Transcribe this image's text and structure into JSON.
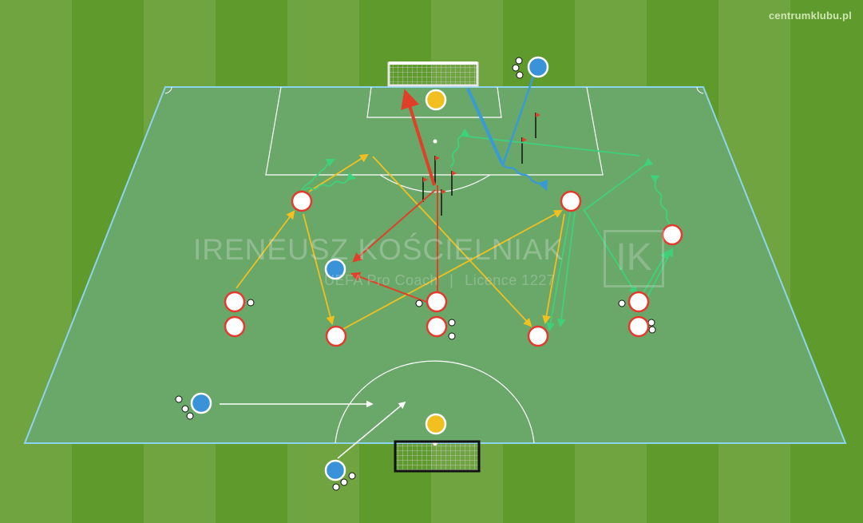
{
  "brand": "centrumklubu.pl",
  "watermark": {
    "name": "IRENEUSZ KOŚCIELNIAK",
    "role": "UEFA Pro Coach",
    "licence": "Licence 1227",
    "separator": "|",
    "logo": "IK"
  },
  "colors": {
    "grass": "#5f9a2c",
    "field": "#6aa86a",
    "field_border": "#8ed3ee",
    "yellow_pass": "#f2c01e",
    "green_run": "#3fd07a",
    "red_path": "#e0402a",
    "blue_path": "#3a9ad4",
    "white_arrow": "#ffffff",
    "player_red": "#e23b2e",
    "player_blue": "#3a93d8",
    "goalkeeper": "#f2c01e"
  },
  "legend_icons": [
    "ball-icon",
    "flag-icon",
    "goal-icon",
    "player-icon"
  ]
}
